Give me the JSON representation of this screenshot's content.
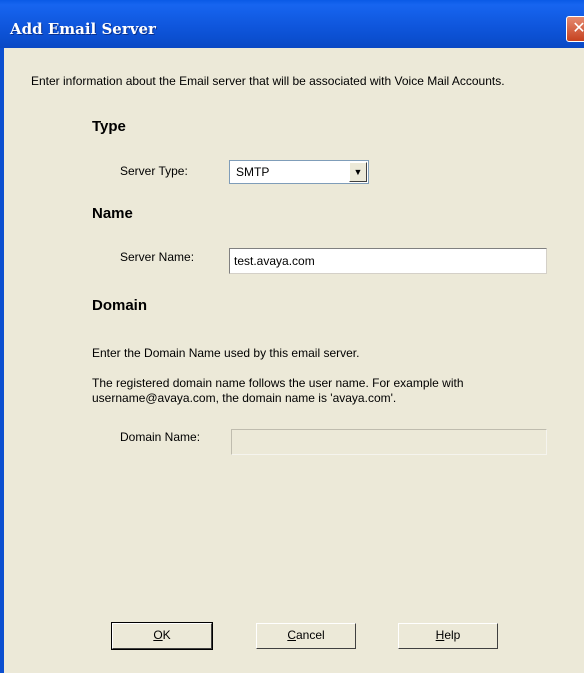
{
  "window": {
    "title": "Add Email Server",
    "close_glyph": "✕"
  },
  "intro": "Enter information about the Email server that will be associated with Voice Mail Accounts.",
  "type_section": {
    "heading": "Type",
    "server_type_label": "Server Type:",
    "server_type_value": "SMTP",
    "dropdown_arrow": "▼"
  },
  "name_section": {
    "heading": "Name",
    "server_name_label": "Server Name:",
    "server_name_value": "test.avaya.com"
  },
  "domain_section": {
    "heading": "Domain",
    "description": "Enter the Domain Name used by this email server.",
    "example": "The registered domain name follows the user name. For example with username@avaya.com, the domain name is 'avaya.com'.",
    "domain_name_label": "Domain Name:",
    "domain_name_value": ""
  },
  "buttons": {
    "ok": {
      "mnemonic": "O",
      "rest": "K"
    },
    "cancel": {
      "mnemonic": "C",
      "rest": "ancel"
    },
    "help": {
      "mnemonic": "H",
      "rest": "elp"
    }
  }
}
